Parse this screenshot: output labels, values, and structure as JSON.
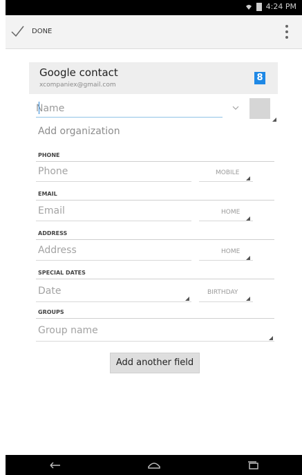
{
  "statusbar": {
    "time": "4:24 PM"
  },
  "actionbar": {
    "done_label": "DONE"
  },
  "account": {
    "title": "Google contact",
    "email": "xcompaniex@gmail.com"
  },
  "name": {
    "placeholder": "Name"
  },
  "organization": {
    "label": "Add organization"
  },
  "sections": {
    "phone": {
      "title": "PHONE",
      "placeholder": "Phone",
      "type": "MOBILE"
    },
    "email": {
      "title": "EMAIL",
      "placeholder": "Email",
      "type": "HOME"
    },
    "address": {
      "title": "ADDRESS",
      "placeholder": "Address",
      "type": "HOME"
    },
    "special_dates": {
      "title": "SPECIAL DATES",
      "placeholder": "Date",
      "type": "BIRTHDAY"
    },
    "groups": {
      "title": "GROUPS",
      "placeholder": "Group name"
    }
  },
  "add_field_button": "Add another field",
  "icons": [
    "wifi-icon",
    "battery-icon",
    "check-icon",
    "overflow-menu-icon",
    "google-icon",
    "chevron-down-icon",
    "back-icon",
    "home-icon",
    "recents-icon"
  ],
  "colors": {
    "accent_blue": "#2b87d8",
    "google_blue": "#1e88e5",
    "bar_black": "#000000"
  }
}
